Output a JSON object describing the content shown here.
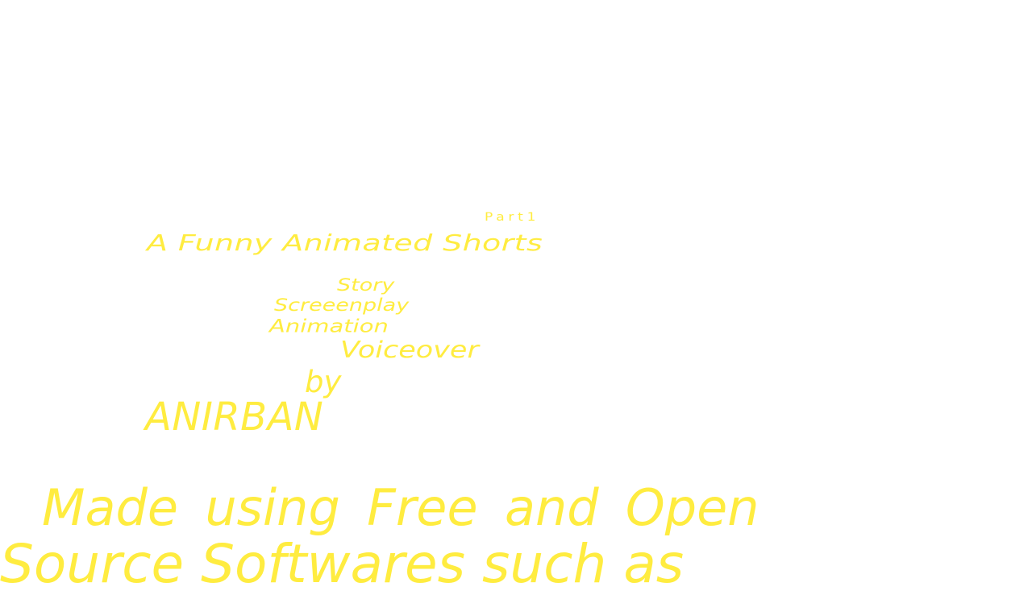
{
  "colors": {
    "background": "#ffffff",
    "text": "#FFEC40"
  },
  "credits": {
    "part": "Part1",
    "subtitle": "A Funny Animated Shorts",
    "roles": [
      "Story",
      "Screeenplay",
      "Animation",
      "Voiceover"
    ],
    "by": "by",
    "author": "ANIRBAN",
    "made_with_line_1": "Made using Free and Open",
    "made_with_line_2": "Source Softwares such as"
  }
}
